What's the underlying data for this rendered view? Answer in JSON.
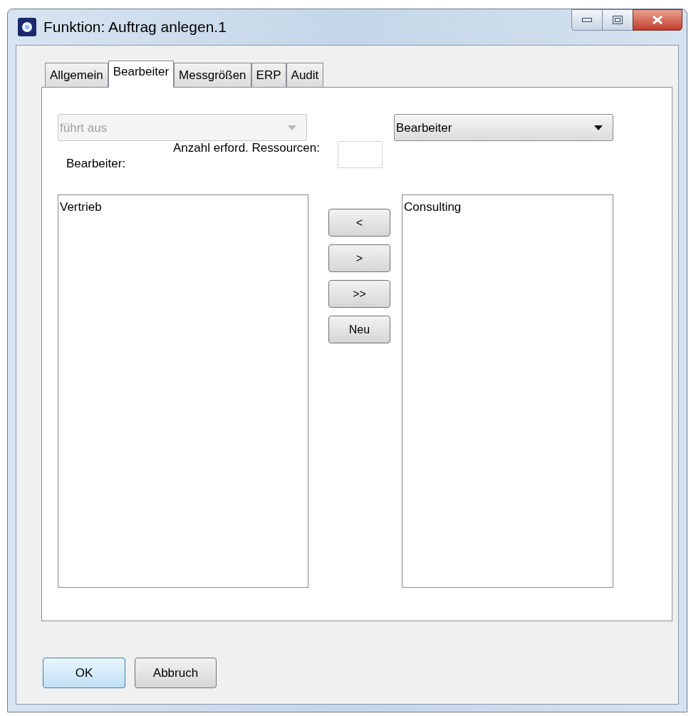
{
  "window": {
    "title": "Funktion: Auftrag anlegen.1"
  },
  "tabs": [
    {
      "label": "Allgemein",
      "selected": false
    },
    {
      "label": "Bearbeiter",
      "selected": true
    },
    {
      "label": "Messgrößen",
      "selected": false
    },
    {
      "label": "ERP",
      "selected": false
    },
    {
      "label": "Audit",
      "selected": false
    }
  ],
  "role_combo": {
    "value": "führt aus",
    "disabled": true
  },
  "type_combo": {
    "value": "Bearbeiter",
    "disabled": false
  },
  "resources": {
    "label": "Anzahl erford. Ressourcen:"
  },
  "assigned_label": "Bearbeiter:",
  "assigned_list": [
    "Vertrieb"
  ],
  "move_buttons": [
    "<",
    ">",
    ">>",
    "Neu"
  ],
  "available_list": [
    "Consulting"
  ],
  "buttons": [
    {
      "label": "OK",
      "default": true
    },
    {
      "label": "Abbruch",
      "default": false
    }
  ]
}
